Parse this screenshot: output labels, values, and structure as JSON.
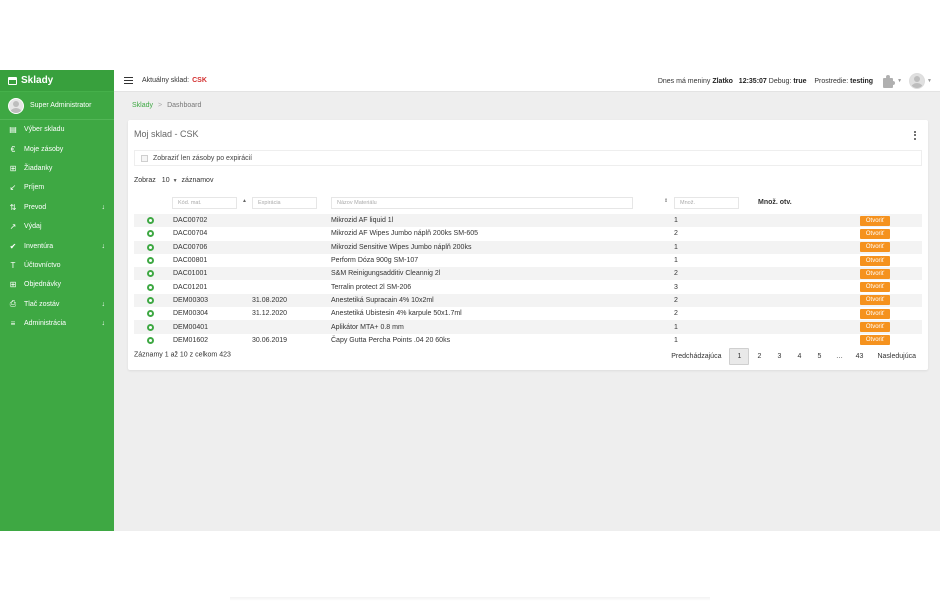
{
  "app": {
    "brand": "Sklady",
    "brand_icon": "warehouse-icon"
  },
  "topbar": {
    "current_label": "Aktuálny sklad:",
    "current_value": "CSK",
    "currency_prefix": "Dnes má meniny",
    "currency_name": "Zlatko",
    "time": "12:35:07",
    "debug_label": "Debug:",
    "debug_value": "true",
    "env_label": "Prostredie:",
    "env_value": "testing"
  },
  "sidebar": {
    "user_name": "Super Administrator",
    "items": [
      {
        "label": "Výber skladu",
        "icon": "warehouse-icon",
        "glyph": "▤",
        "chevron": false
      },
      {
        "label": "Moje zásoby",
        "icon": "euro-icon",
        "glyph": "€",
        "chevron": false
      },
      {
        "label": "Žiadanky",
        "icon": "cart-icon",
        "glyph": "⊞",
        "chevron": false
      },
      {
        "label": "Príjem",
        "icon": "arrow-in-icon",
        "glyph": "↙",
        "chevron": false
      },
      {
        "label": "Prevod",
        "icon": "transfer-icon",
        "glyph": "⇅",
        "chevron": true
      },
      {
        "label": "Výdaj",
        "icon": "arrow-out-icon",
        "glyph": "↗",
        "chevron": false
      },
      {
        "label": "Inventúra",
        "icon": "check-circle-icon",
        "glyph": "✔",
        "chevron": true
      },
      {
        "label": "Účtovníctvo",
        "icon": "text-icon",
        "glyph": "T",
        "chevron": false
      },
      {
        "label": "Objednávky",
        "icon": "cart-icon",
        "glyph": "⊞",
        "chevron": false
      },
      {
        "label": "Tlač zostáv",
        "icon": "print-icon",
        "glyph": "⎙",
        "chevron": true
      },
      {
        "label": "Administrácia",
        "icon": "list-icon",
        "glyph": "≡",
        "chevron": true
      }
    ]
  },
  "breadcrumb": {
    "root": "Sklady",
    "separator": ">",
    "current": "Dashboard"
  },
  "card": {
    "title": "Moj sklad - CSK",
    "filter_label": "Zobraziť len zásoby po expirácií",
    "show_prefix": "Zobraz",
    "page_size": "10",
    "show_suffix": "záznamov"
  },
  "table": {
    "col_code_ph": "Kód. mat.",
    "col_exp_ph": "Expirácia",
    "col_name_ph": "Názov Materiálu",
    "col_qty_ph": "Množ.",
    "col_qty_ot": "Množ. otv.",
    "open_label": "Otvoriť",
    "rows": [
      {
        "code": "DAC00702",
        "exp": "",
        "name": "Mikrozid AF liquid 1l",
        "qty": "1"
      },
      {
        "code": "DAC00704",
        "exp": "",
        "name": "Mikrozid AF Wipes Jumbo náplň 200ks SM-605",
        "qty": "2"
      },
      {
        "code": "DAC00706",
        "exp": "",
        "name": "Mikrozid Sensitive Wipes Jumbo náplň 200ks",
        "qty": "1"
      },
      {
        "code": "DAC00801",
        "exp": "",
        "name": "Perform Dóza 900g  SM-107",
        "qty": "1"
      },
      {
        "code": "DAC01001",
        "exp": "",
        "name": "S&M Reinigungsadditiv Cleannig 2l",
        "qty": "2"
      },
      {
        "code": "DAC01201",
        "exp": "",
        "name": "Terralin protect 2l SM-206",
        "qty": "3"
      },
      {
        "code": "DEM00303",
        "exp": "31.08.2020",
        "name": "Anestetiká Supracain 4% 10x2ml",
        "qty": "2"
      },
      {
        "code": "DEM00304",
        "exp": "31.12.2020",
        "name": "Anestetiká Ubistesin 4% karpule 50x1.7ml",
        "qty": "2"
      },
      {
        "code": "DEM00401",
        "exp": "",
        "name": "Aplikátor MTA+ 0.8 mm",
        "qty": "1"
      },
      {
        "code": "DEM01602",
        "exp": "30.06.2019",
        "name": "Čapy Gutta Percha Points .04 20 60ks",
        "qty": "1"
      }
    ]
  },
  "footer": {
    "info": "Záznamy 1 až 10 z celkom 423",
    "prev": "Predchádzajúca",
    "pages": [
      "1",
      "2",
      "3",
      "4",
      "5",
      "…",
      "43"
    ],
    "active_page": "1",
    "next": "Nasledujúca"
  },
  "colors": {
    "accent": "#3ea843",
    "open_button": "#f5921e",
    "warehouse_code": "#d32f2f"
  }
}
